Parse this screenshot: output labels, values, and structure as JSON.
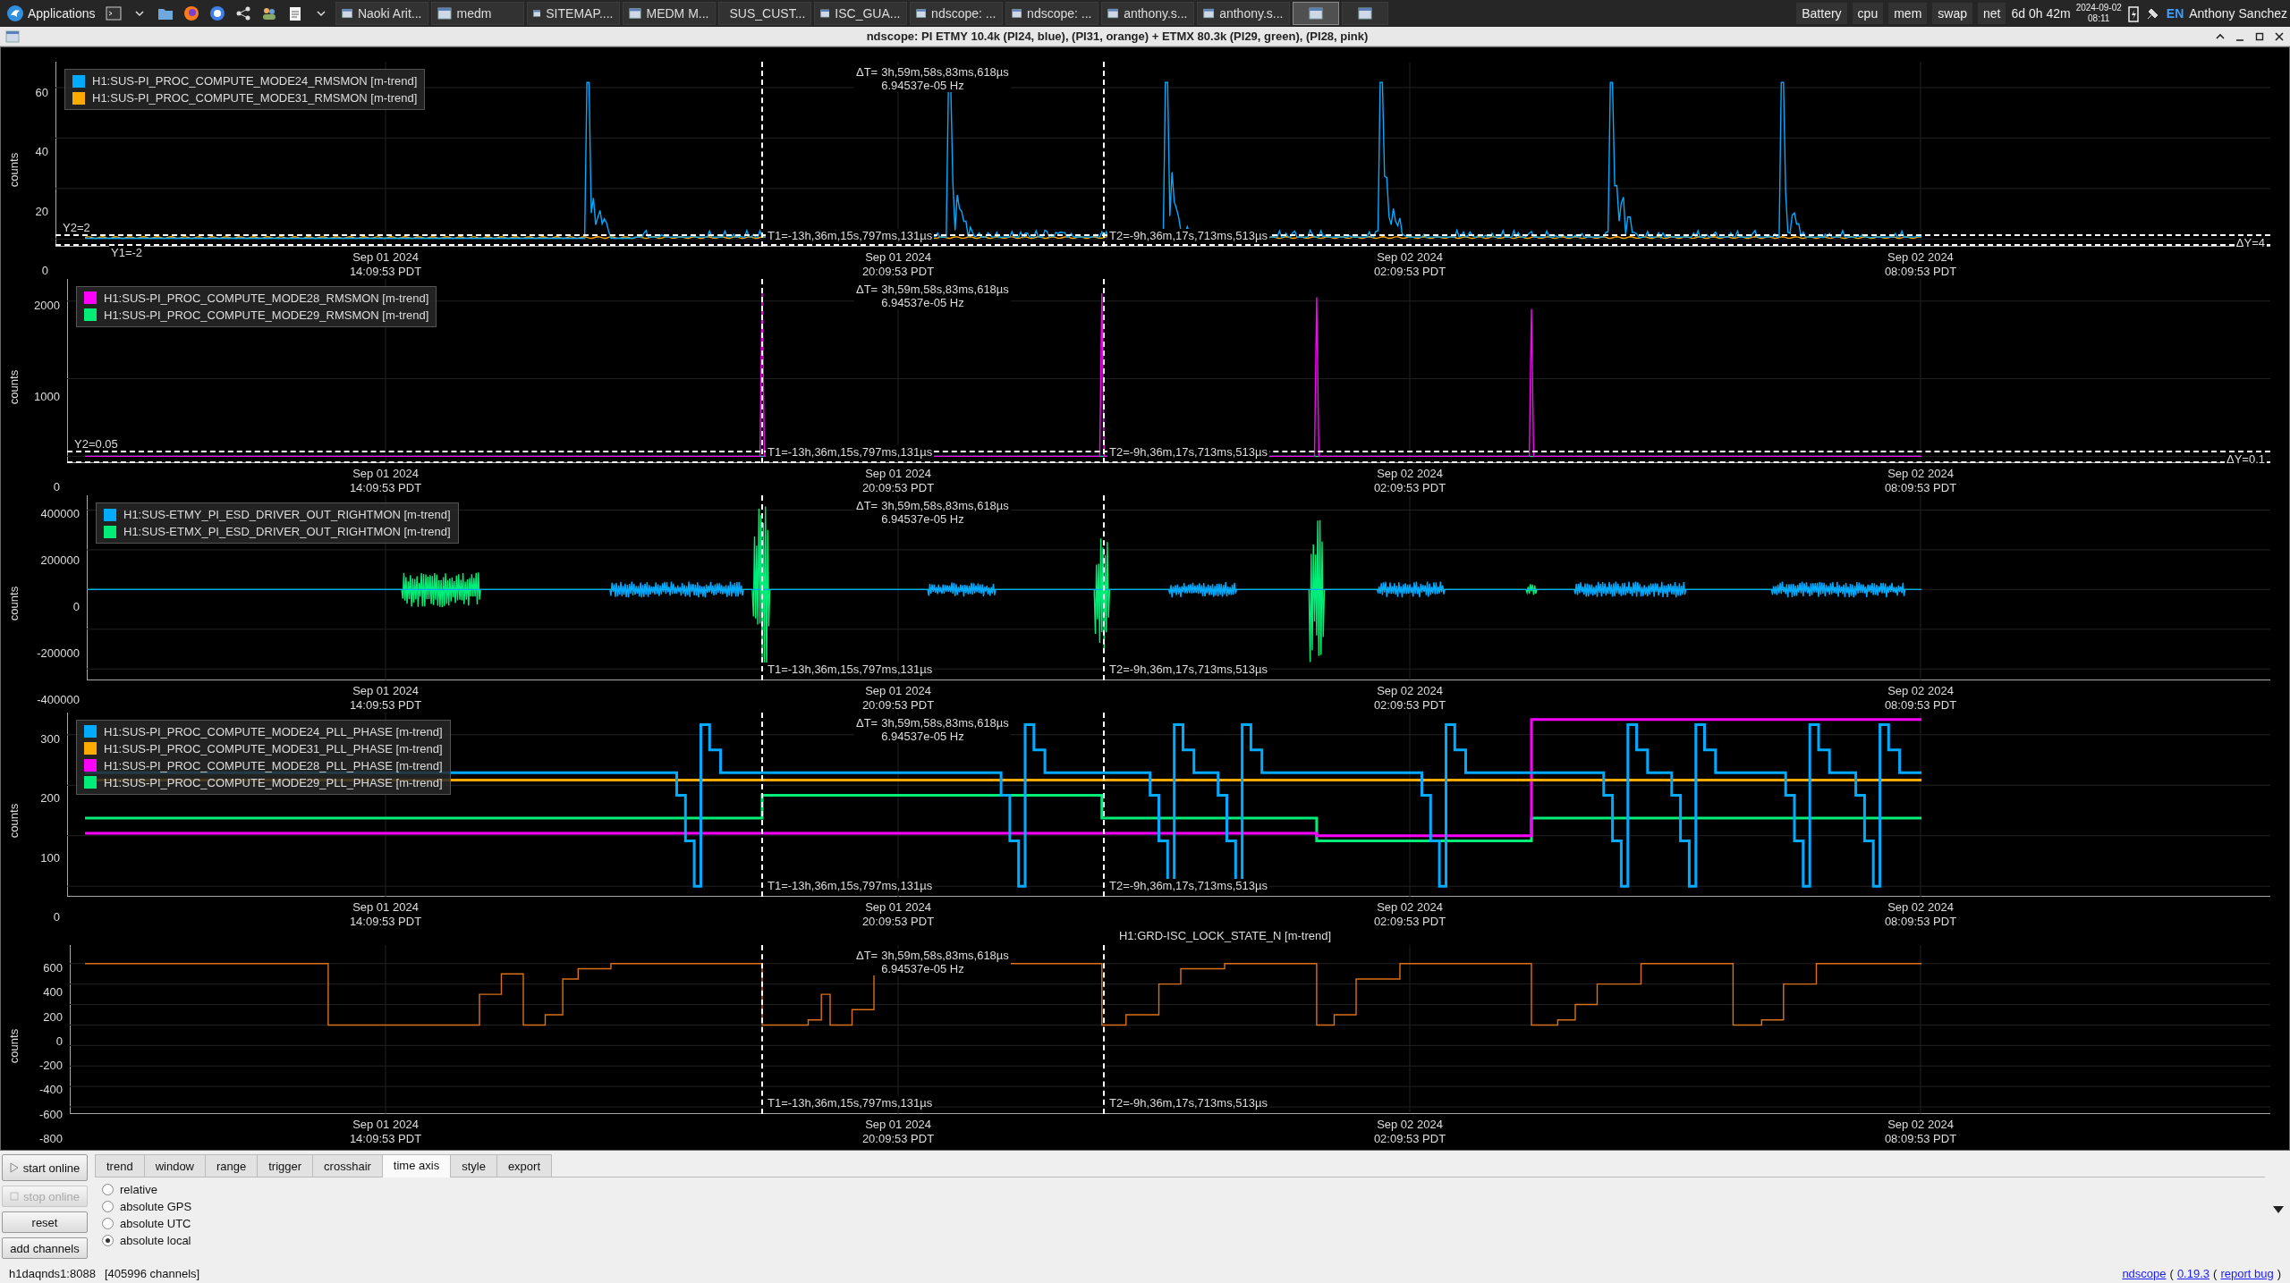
{
  "taskbar": {
    "menu_label": "Applications",
    "tasks": [
      {
        "kind": "labeled",
        "label": "Naoki Arit...",
        "selected": false
      },
      {
        "kind": "labeled",
        "label": "medm",
        "selected": false
      },
      {
        "kind": "labeled",
        "label": "SITEMAP....",
        "selected": false
      },
      {
        "kind": "labeled",
        "label": "MEDM M...",
        "selected": false
      },
      {
        "kind": "labeled",
        "label": "SUS_CUST...",
        "selected": false
      },
      {
        "kind": "labeled",
        "label": "ISC_GUA...",
        "selected": false
      },
      {
        "kind": "labeled",
        "label": "ndscope: ...",
        "selected": false
      },
      {
        "kind": "labeled",
        "label": "ndscope: ...",
        "selected": false
      },
      {
        "kind": "labeled",
        "label": "anthony.s...",
        "selected": false
      },
      {
        "kind": "labeled",
        "label": "anthony.s...",
        "selected": false
      },
      {
        "kind": "icon",
        "selected": true
      },
      {
        "kind": "icon",
        "selected": false
      }
    ],
    "tray": {
      "items": [
        "Battery",
        "cpu",
        "mem",
        "swap",
        "net"
      ],
      "uptime": "6d 0h 42m",
      "date": "2024-09-02",
      "time": "08:11",
      "keyboard_layout": "EN",
      "user": "Anthony Sanchez"
    }
  },
  "window": {
    "title": "ndscope: PI ETMY 10.4k (PI24, blue), (PI31, orange) + ETMX 80.3k (PI29, green), (PI28, pink)"
  },
  "plots": [
    {
      "legend": [
        {
          "label": "H1:SUS-PI_PROC_COMPUTE_MODE24_RMSMON [m-trend]",
          "color": "#00aaff"
        },
        {
          "label": "H1:SUS-PI_PROC_COMPUTE_MODE31_RMSMON [m-trend]",
          "color": "#ffaa00"
        }
      ],
      "yaxis_label": "counts",
      "yticks": [
        "60",
        "40",
        "20",
        "0"
      ],
      "xticks": [
        {
          "date": "Sep 01 2024",
          "time": "14:09:53 PDT"
        },
        {
          "date": "Sep 01 2024",
          "time": "20:09:53 PDT"
        },
        {
          "date": "Sep 02 2024",
          "time": "02:09:53 PDT"
        },
        {
          "date": "Sep 02 2024",
          "time": "08:09:53 PDT"
        }
      ],
      "cursors": {
        "t1_label": "T1=-13h,36m,15s,797ms,131µs",
        "t2_label": "T2=-9h,36m,17s,713ms,513µs",
        "delta_t_label": "ΔT=",
        "delta_t": "3h,59m,58s,83ms,618µs",
        "delta_freq": "6.94537e-05 Hz",
        "y2_label": "Y2=2",
        "y1_label": "Y1=-2",
        "delta_y": "ΔY=4"
      }
    },
    {
      "legend": [
        {
          "label": "H1:SUS-PI_PROC_COMPUTE_MODE28_RMSMON [m-trend]",
          "color": "#ff00ff"
        },
        {
          "label": "H1:SUS-PI_PROC_COMPUTE_MODE29_RMSMON [m-trend]",
          "color": "#00ee77"
        }
      ],
      "yaxis_label": "counts",
      "yticks": [
        "2000",
        "1000",
        "0"
      ],
      "xticks": [
        {
          "date": "Sep 01 2024",
          "time": "14:09:53 PDT"
        },
        {
          "date": "Sep 01 2024",
          "time": "20:09:53 PDT"
        },
        {
          "date": "Sep 02 2024",
          "time": "02:09:53 PDT"
        },
        {
          "date": "Sep 02 2024",
          "time": "08:09:53 PDT"
        }
      ],
      "cursors": {
        "t1_label": "T1=-13h,36m,15s,797ms,131µs",
        "t2_label": "T2=-9h,36m,17s,713ms,513µs",
        "delta_t_label": "ΔT=",
        "delta_t": "3h,59m,58s,83ms,618µs",
        "delta_freq": "6.94537e-05 Hz",
        "y2_label": "Y2=0.05",
        "delta_y": "ΔY=0.1"
      }
    },
    {
      "legend": [
        {
          "label": "H1:SUS-ETMY_PI_ESD_DRIVER_OUT_RIGHTMON [m-trend]",
          "color": "#00aaff"
        },
        {
          "label": "H1:SUS-ETMX_PI_ESD_DRIVER_OUT_RIGHTMON [m-trend]",
          "color": "#00ee77"
        }
      ],
      "yaxis_label": "counts",
      "yticks": [
        "400000",
        "200000",
        "0",
        "-200000",
        "-400000"
      ],
      "xticks": [
        {
          "date": "Sep 01 2024",
          "time": "14:09:53 PDT"
        },
        {
          "date": "Sep 01 2024",
          "time": "20:09:53 PDT"
        },
        {
          "date": "Sep 02 2024",
          "time": "02:09:53 PDT"
        },
        {
          "date": "Sep 02 2024",
          "time": "08:09:53 PDT"
        }
      ],
      "cursors": {
        "t1_label": "T1=-13h,36m,15s,797ms,131µs",
        "t2_label": "T2=-9h,36m,17s,713ms,513µs",
        "delta_t_label": "ΔT=",
        "delta_t": "3h,59m,58s,83ms,618µs",
        "delta_freq": "6.94537e-05 Hz"
      }
    },
    {
      "legend": [
        {
          "label": "H1:SUS-PI_PROC_COMPUTE_MODE24_PLL_PHASE [m-trend]",
          "color": "#00aaff"
        },
        {
          "label": "H1:SUS-PI_PROC_COMPUTE_MODE31_PLL_PHASE [m-trend]",
          "color": "#ffaa00"
        },
        {
          "label": "H1:SUS-PI_PROC_COMPUTE_MODE28_PLL_PHASE [m-trend]",
          "color": "#ff00ff"
        },
        {
          "label": "H1:SUS-PI_PROC_COMPUTE_MODE29_PLL_PHASE [m-trend]",
          "color": "#00ee77"
        }
      ],
      "yaxis_label": "counts",
      "yticks": [
        "300",
        "200",
        "100",
        "0"
      ],
      "xticks": [
        {
          "date": "Sep 01 2024",
          "time": "14:09:53 PDT"
        },
        {
          "date": "Sep 01 2024",
          "time": "20:09:53 PDT"
        },
        {
          "date": "Sep 02 2024",
          "time": "02:09:53 PDT"
        },
        {
          "date": "Sep 02 2024",
          "time": "08:09:53 PDT"
        }
      ],
      "cursors": {
        "t1_label": "T1=-13h,36m,15s,797ms,131µs",
        "t2_label": "T2=-9h,36m,17s,713ms,513µs",
        "delta_t_label": "ΔT=",
        "delta_t": "3h,59m,58s,83ms,618µs",
        "delta_freq": "6.94537e-05 Hz"
      }
    },
    {
      "title": "H1:GRD-ISC_LOCK_STATE_N [m-trend]",
      "yaxis_label": "counts",
      "yticks": [
        "600",
        "400",
        "200",
        "0",
        "-200",
        "-400",
        "-600",
        "-800"
      ],
      "xticks": [
        {
          "date": "Sep 01 2024",
          "time": "14:09:53 PDT"
        },
        {
          "date": "Sep 01 2024",
          "time": "20:09:53 PDT"
        },
        {
          "date": "Sep 02 2024",
          "time": "02:09:53 PDT"
        },
        {
          "date": "Sep 02 2024",
          "time": "08:09:53 PDT"
        }
      ],
      "cursors": {
        "t1_label": "T1=-13h,36m,15s,797ms,131µs",
        "t2_label": "T2=-9h,36m,17s,713ms,513µs",
        "delta_t_label": "ΔT=",
        "delta_t": "3h,59m,58s,83ms,618µs",
        "delta_freq": "6.94537e-05 Hz"
      }
    }
  ],
  "controls": {
    "buttons": [
      {
        "kind": "play",
        "label": "start online",
        "disabled": false
      },
      {
        "kind": "stop",
        "label": "stop online",
        "disabled": true
      },
      {
        "kind": "plain",
        "label": "reset",
        "disabled": false
      },
      {
        "kind": "plain",
        "label": "add channels",
        "disabled": false
      }
    ],
    "tabs": [
      {
        "label": "trend",
        "selected": false
      },
      {
        "label": "window",
        "selected": false
      },
      {
        "label": "range",
        "selected": false
      },
      {
        "label": "trigger",
        "selected": false
      },
      {
        "label": "crosshair",
        "selected": false
      },
      {
        "label": "time axis",
        "selected": true
      },
      {
        "label": "style",
        "selected": false
      },
      {
        "label": "export",
        "selected": false
      }
    ],
    "time_axis_options": [
      {
        "label": "relative",
        "selected": false
      },
      {
        "label": "absolute GPS",
        "selected": false
      },
      {
        "label": "absolute UTC",
        "selected": false
      },
      {
        "label": "absolute local",
        "selected": true
      }
    ]
  },
  "status_bar": {
    "server": "h1daqnds1:8088",
    "channels": "[405996 channels]",
    "footer": [
      {
        "kind": "link",
        "text": "ndscope"
      },
      {
        "kind": "text",
        "text": "("
      },
      {
        "kind": "link",
        "text": "0.19.3"
      },
      {
        "kind": "text",
        "text": "("
      },
      {
        "kind": "link",
        "text": "report bug"
      },
      {
        "kind": "text",
        "text": ")"
      }
    ]
  }
}
